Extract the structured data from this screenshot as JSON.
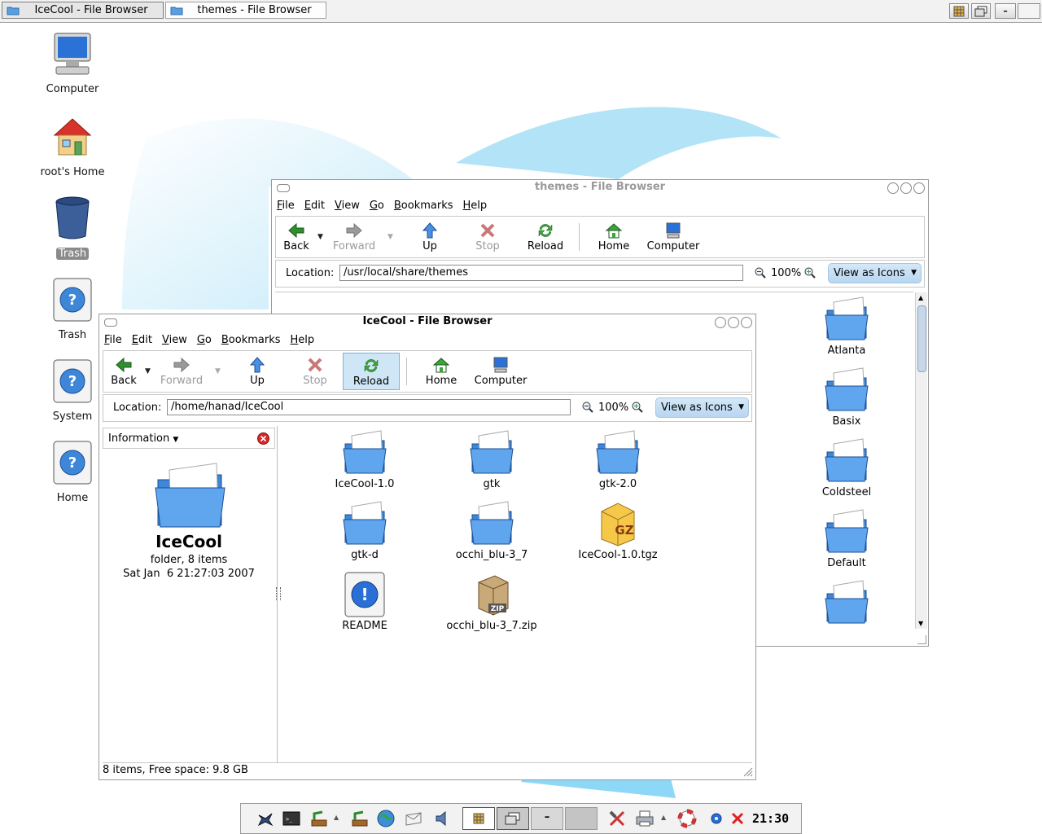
{
  "taskbar": {
    "tasks": [
      {
        "label": "IceCool - File Browser",
        "active": true
      },
      {
        "label": "themes - File Browser",
        "active": false
      }
    ]
  },
  "desktop": {
    "icons": [
      {
        "label": "Computer",
        "icon": "computer-icon"
      },
      {
        "label": "root's Home",
        "icon": "home-folder-icon"
      },
      {
        "label": "Trash",
        "icon": "trash-icon"
      },
      {
        "label": "Trash",
        "icon": "help-icon"
      },
      {
        "label": "System",
        "icon": "help-icon"
      },
      {
        "label": "Home",
        "icon": "help-icon"
      }
    ]
  },
  "themes_window": {
    "title": "themes - File Browser",
    "menu": [
      "File",
      "Edit",
      "View",
      "Go",
      "Bookmarks",
      "Help"
    ],
    "toolbar": {
      "back": "Back",
      "forward": "Forward",
      "up": "Up",
      "stop": "Stop",
      "reload": "Reload",
      "home": "Home",
      "computer": "Computer"
    },
    "location_label": "Location:",
    "location": "/usr/local/share/themes",
    "zoom": "100%",
    "view_mode": "View as Icons",
    "items": [
      "Atlanta",
      "Basix",
      "Coldsteel",
      "Default"
    ]
  },
  "icecool_window": {
    "title": "IceCool - File Browser",
    "menu": [
      "File",
      "Edit",
      "View",
      "Go",
      "Bookmarks",
      "Help"
    ],
    "toolbar": {
      "back": "Back",
      "forward": "Forward",
      "up": "Up",
      "stop": "Stop",
      "reload": "Reload",
      "home": "Home",
      "computer": "Computer"
    },
    "location_label": "Location:",
    "location": "/home/hanad/IceCool",
    "zoom": "100%",
    "view_mode": "View as Icons",
    "sidebar": {
      "header": "Information",
      "folder_name": "IceCool",
      "folder_desc": "folder, 8 items",
      "date": "Sat Jan  6 21:27:03 2007"
    },
    "files": [
      {
        "name": "IceCool-1.0",
        "type": "folder"
      },
      {
        "name": "gtk",
        "type": "folder"
      },
      {
        "name": "gtk-2.0",
        "type": "folder"
      },
      {
        "name": "gtk-d",
        "type": "folder"
      },
      {
        "name": "occhi_blu-3_7",
        "type": "folder"
      },
      {
        "name": "IceCool-1.0.tgz",
        "type": "gz"
      },
      {
        "name": "README",
        "type": "readme"
      },
      {
        "name": "occhi_blu-3_7.zip",
        "type": "zip"
      }
    ],
    "status": "8 items, Free space: 9.8 GB"
  },
  "clock": "21:30",
  "colors": {
    "accent_blue": "#3d86d8",
    "view_button": "#c3dcf2",
    "pressed": "#cfe6f7"
  }
}
